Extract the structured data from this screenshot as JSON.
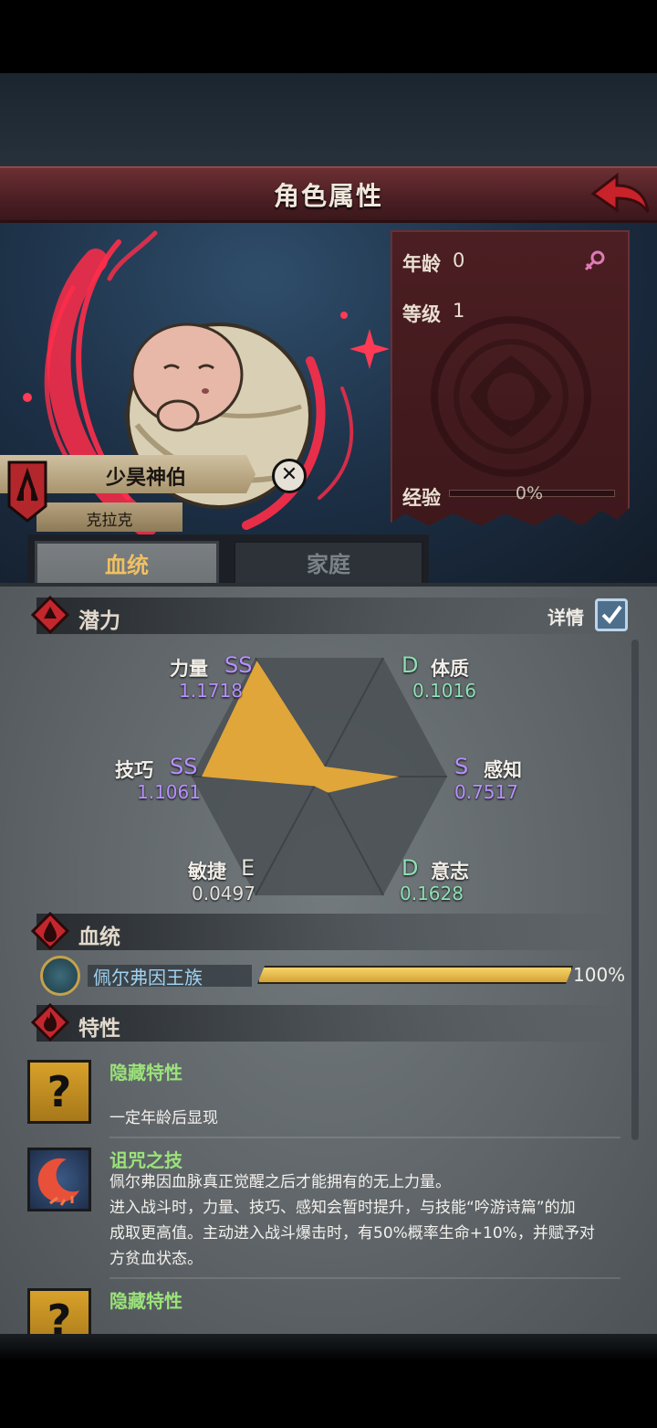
{
  "header": {
    "title": "角色属性"
  },
  "character": {
    "name": "少昊神伯",
    "family": "克拉克"
  },
  "stats": {
    "age_label": "年龄",
    "age_value": "0",
    "level_label": "等级",
    "level_value": "1",
    "exp_label": "经验",
    "exp_value": "0%",
    "exp_fraction": 0
  },
  "tabs": [
    {
      "label": "血统",
      "active": true
    },
    {
      "label": "家庭",
      "active": false
    }
  ],
  "potential": {
    "title": "潜力",
    "detail_label": "详情",
    "detail_checked": true,
    "attributes": [
      {
        "name": "力量",
        "grade": "SS",
        "value": "1.1718"
      },
      {
        "name": "体质",
        "grade": "D",
        "value": "0.1016"
      },
      {
        "name": "感知",
        "grade": "S",
        "value": "0.7517"
      },
      {
        "name": "意志",
        "grade": "D",
        "value": "0.1628"
      },
      {
        "name": "敏捷",
        "grade": "E",
        "value": "0.0497"
      },
      {
        "name": "技巧",
        "grade": "SS",
        "value": "1.1061"
      }
    ]
  },
  "bloodline": {
    "title": "血统",
    "name": "佩尔弗因王族",
    "percent": "100%",
    "fraction": 1.0
  },
  "traits": {
    "title": "特性",
    "items": [
      {
        "title": "隐藏特性",
        "desc": [
          "一定年龄后显现"
        ]
      },
      {
        "title": "诅咒之技",
        "desc": [
          "佩尔弗因血脉真正觉醒之后才能拥有的无上力量。",
          "进入战斗时，力量、技巧、感知会暂时提升，与技能“吟游诗篇”的加",
          "成取更高值。主动进入战斗爆击时，有50%概率生命+10%，并赋予对",
          "方贫血状态。"
        ]
      },
      {
        "title": "隐藏特性",
        "desc": []
      }
    ]
  },
  "colors": {
    "title_bar": "#5a262b",
    "accent_gold": "#f0c060",
    "grade_purple": "#b890ff",
    "grade_green": "#8fe0b4",
    "radar_fill": "#e0a63a",
    "trait_title": "#9be27a"
  }
}
